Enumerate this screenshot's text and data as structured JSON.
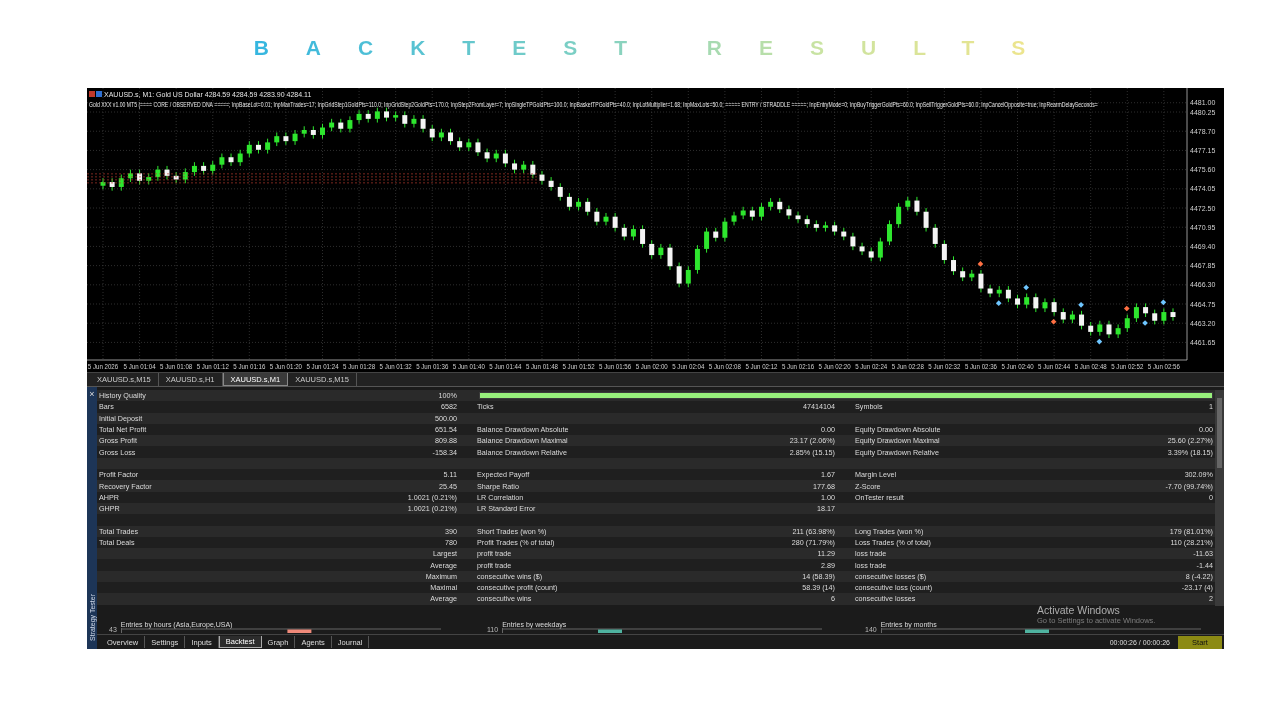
{
  "title": "BACKTEST RESULTS",
  "chart": {
    "symbol_line": "XAUUSD.s, M1:  Gold US Dollar  4284.59 4284.59 4283.90 4284.11",
    "parameters_line": "Gold XXX v1.00 MT5 (==== CORE / OBSERVED DNA =====; InpBaseLot=0.01; InpMaxTrades=17; InpGridStep1GoldPts=110.0; InpGridStep2GoldPts=170.0; InpStep2FromLayer=7; InpSingleTPGoldPts=100.0; InpBasketTPGoldPts=40.0; InpLotMultiplier=1.68; InpMaxLots=50.0; ===== ENTRY / STRADDLE =====; InpEntryMode=0; InpBuyTriggerGoldPts=60.0; InpSellTriggerGoldPts=60.0; InpCancelOpposite=true; InpRearmDelaySeconds=",
    "chart_data": {
      "type": "candlestick",
      "categories": [
        "5 Jun 2026",
        null,
        null,
        null,
        "5 Jun 01:04",
        null,
        null,
        null,
        "5 Jun 01:08",
        null,
        null,
        null,
        "5 Jun 01:12",
        null,
        null,
        null,
        "5 Jun 01:16",
        null,
        null,
        null,
        "5 Jun 01:20",
        null,
        null,
        null,
        "5 Jun 01:24",
        null,
        null,
        null,
        "5 Jun 01:28",
        null,
        null,
        null,
        "5 Jun 01:32",
        null,
        null,
        null,
        "5 Jun 01:36",
        null,
        null,
        null,
        "5 Jun 01:40",
        null,
        null,
        null,
        "5 Jun 01:44",
        null,
        null,
        null,
        "5 Jun 01:48",
        null,
        null,
        null,
        "5 Jun 01:52",
        null,
        null,
        null,
        "5 Jun 01:56",
        null,
        null,
        null,
        "5 Jun 02:00",
        null,
        null,
        null,
        "5 Jun 02:04",
        null,
        null,
        null,
        "5 Jun 02:08",
        null,
        null,
        null,
        "5 Jun 02:12",
        null,
        null,
        null,
        "5 Jun 02:16",
        null,
        null,
        null,
        "5 Jun 02:20",
        null,
        null,
        null,
        "5 Jun 02:24",
        null,
        null,
        null,
        "5 Jun 02:28",
        null,
        null,
        null,
        "5 Jun 02:32",
        null,
        null,
        null,
        "5 Jun 02:36",
        null,
        null,
        null,
        "5 Jun 02:40",
        null,
        null,
        null,
        "5 Jun 02:44",
        null,
        null,
        null,
        "5 Jun 02:48",
        null,
        null,
        null,
        "5 Jun 02:52",
        null,
        null,
        null,
        "5 Jun 02:56",
        null
      ],
      "ylim": [
        4460.23,
        4482.19
      ],
      "grid": true,
      "ohlc": [
        [
          4474.3,
          4474.9,
          4474.0,
          4474.6
        ],
        [
          4474.6,
          4474.9,
          4473.9,
          4474.2
        ],
        [
          4474.2,
          4475.2,
          4473.9,
          4474.9
        ],
        [
          4474.9,
          4475.6,
          4474.6,
          4475.3
        ],
        [
          4475.3,
          4475.6,
          4474.4,
          4474.7
        ],
        [
          4474.7,
          4475.3,
          4474.4,
          4475.0
        ],
        [
          4475.0,
          4475.9,
          4474.7,
          4475.6
        ],
        [
          4475.6,
          4475.9,
          4474.8,
          4475.1
        ],
        [
          4475.1,
          4475.4,
          4474.5,
          4474.8
        ],
        [
          4474.8,
          4475.7,
          4474.5,
          4475.4
        ],
        [
          4475.4,
          4476.2,
          4475.1,
          4475.9
        ],
        [
          4475.9,
          4476.2,
          4475.2,
          4475.5
        ],
        [
          4475.5,
          4476.3,
          4475.2,
          4476.0
        ],
        [
          4476.0,
          4476.9,
          4475.7,
          4476.6
        ],
        [
          4476.6,
          4476.9,
          4475.9,
          4476.2
        ],
        [
          4476.2,
          4477.2,
          4475.9,
          4476.9
        ],
        [
          4476.9,
          4477.9,
          4476.6,
          4477.6
        ],
        [
          4477.6,
          4477.9,
          4476.9,
          4477.2
        ],
        [
          4477.2,
          4478.1,
          4476.9,
          4477.8
        ],
        [
          4477.8,
          4478.6,
          4477.5,
          4478.3
        ],
        [
          4478.3,
          4478.6,
          4477.6,
          4477.9
        ],
        [
          4477.9,
          4478.8,
          4477.6,
          4478.5
        ],
        [
          4478.5,
          4479.1,
          4478.2,
          4478.8
        ],
        [
          4478.8,
          4479.1,
          4478.1,
          4478.4
        ],
        [
          4478.4,
          4479.3,
          4478.1,
          4479.0
        ],
        [
          4479.0,
          4479.7,
          4478.7,
          4479.4
        ],
        [
          4479.4,
          4479.7,
          4478.6,
          4478.9
        ],
        [
          4478.9,
          4479.9,
          4478.6,
          4479.6
        ],
        [
          4479.6,
          4480.4,
          4479.3,
          4480.1
        ],
        [
          4480.1,
          4480.4,
          4479.4,
          4479.7
        ],
        [
          4479.7,
          4480.6,
          4479.4,
          4480.3
        ],
        [
          4480.3,
          4480.6,
          4479.5,
          4479.8
        ],
        [
          4479.8,
          4480.3,
          4479.5,
          4480.0
        ],
        [
          4480.0,
          4480.3,
          4479.0,
          4479.3
        ],
        [
          4479.3,
          4480.0,
          4479.0,
          4479.7
        ],
        [
          4479.7,
          4480.0,
          4478.6,
          4478.9
        ],
        [
          4478.9,
          4479.2,
          4477.9,
          4478.2
        ],
        [
          4478.2,
          4478.9,
          4477.9,
          4478.6
        ],
        [
          4478.6,
          4478.9,
          4477.6,
          4477.9
        ],
        [
          4477.9,
          4478.2,
          4477.1,
          4477.4
        ],
        [
          4477.4,
          4478.1,
          4477.1,
          4477.8
        ],
        [
          4477.8,
          4478.1,
          4476.7,
          4477.0
        ],
        [
          4477.0,
          4477.3,
          4476.2,
          4476.5
        ],
        [
          4476.5,
          4477.2,
          4476.2,
          4476.9
        ],
        [
          4476.9,
          4477.2,
          4475.8,
          4476.1
        ],
        [
          4476.1,
          4476.4,
          4475.3,
          4475.6
        ],
        [
          4475.6,
          4476.3,
          4475.3,
          4476.0
        ],
        [
          4476.0,
          4476.3,
          4474.9,
          4475.2
        ],
        [
          4475.2,
          4475.5,
          4474.4,
          4474.7
        ],
        [
          4474.7,
          4475.0,
          4473.9,
          4474.2
        ],
        [
          4474.2,
          4474.5,
          4473.1,
          4473.4
        ],
        [
          4473.4,
          4473.7,
          4472.3,
          4472.6
        ],
        [
          4472.6,
          4473.3,
          4472.3,
          4473.0
        ],
        [
          4473.0,
          4473.3,
          4471.9,
          4472.2
        ],
        [
          4472.2,
          4472.5,
          4471.1,
          4471.4
        ],
        [
          4471.4,
          4472.1,
          4471.1,
          4471.8
        ],
        [
          4471.8,
          4472.1,
          4470.6,
          4470.9
        ],
        [
          4470.9,
          4471.2,
          4469.9,
          4470.2
        ],
        [
          4470.2,
          4471.1,
          4469.9,
          4470.8
        ],
        [
          4470.8,
          4471.1,
          4469.3,
          4469.6
        ],
        [
          4469.6,
          4469.9,
          4468.4,
          4468.7
        ],
        [
          4468.7,
          4469.6,
          4468.4,
          4469.3
        ],
        [
          4469.3,
          4469.6,
          4467.5,
          4467.8
        ],
        [
          4467.8,
          4468.1,
          4466.1,
          4466.4
        ],
        [
          4466.4,
          4467.8,
          4466.1,
          4467.5
        ],
        [
          4467.5,
          4469.5,
          4467.2,
          4469.2
        ],
        [
          4469.2,
          4470.9,
          4468.9,
          4470.6
        ],
        [
          4470.6,
          4470.9,
          4469.8,
          4470.1
        ],
        [
          4470.1,
          4471.7,
          4469.8,
          4471.4
        ],
        [
          4471.4,
          4472.2,
          4471.1,
          4471.9
        ],
        [
          4471.9,
          4472.6,
          4471.6,
          4472.3
        ],
        [
          4472.3,
          4472.6,
          4471.5,
          4471.8
        ],
        [
          4471.8,
          4472.9,
          4471.5,
          4472.6
        ],
        [
          4472.6,
          4473.3,
          4472.3,
          4473.0
        ],
        [
          4473.0,
          4473.3,
          4472.1,
          4472.4
        ],
        [
          4472.4,
          4472.7,
          4471.6,
          4471.9
        ],
        [
          4471.9,
          4472.2,
          4471.3,
          4471.6
        ],
        [
          4471.6,
          4471.9,
          4470.9,
          4471.2
        ],
        [
          4471.2,
          4471.5,
          4470.6,
          4470.9
        ],
        [
          4470.9,
          4471.4,
          4470.6,
          4471.1
        ],
        [
          4471.1,
          4471.4,
          4470.3,
          4470.6
        ],
        [
          4470.6,
          4470.9,
          4469.9,
          4470.2
        ],
        [
          4470.2,
          4470.5,
          4469.1,
          4469.4
        ],
        [
          4469.4,
          4469.7,
          4468.7,
          4469.0
        ],
        [
          4469.0,
          4469.3,
          4468.2,
          4468.5
        ],
        [
          4468.5,
          4470.1,
          4468.2,
          4469.8
        ],
        [
          4469.8,
          4471.5,
          4469.5,
          4471.2
        ],
        [
          4471.2,
          4472.9,
          4470.9,
          4472.6
        ],
        [
          4472.6,
          4473.4,
          4472.3,
          4473.1
        ],
        [
          4473.1,
          4473.4,
          4471.9,
          4472.2
        ],
        [
          4472.2,
          4472.5,
          4470.6,
          4470.9
        ],
        [
          4470.9,
          4471.2,
          4469.3,
          4469.6
        ],
        [
          4469.6,
          4469.9,
          4468.0,
          4468.3
        ],
        [
          4468.3,
          4468.6,
          4467.1,
          4467.4
        ],
        [
          4467.4,
          4467.7,
          4466.6,
          4466.9
        ],
        [
          4466.9,
          4467.5,
          4466.6,
          4467.2
        ],
        [
          4467.2,
          4467.5,
          4465.7,
          4466.0
        ],
        [
          4466.0,
          4466.3,
          4465.3,
          4465.6
        ],
        [
          4465.6,
          4466.2,
          4465.3,
          4465.9
        ],
        [
          4465.9,
          4466.2,
          4464.9,
          4465.2
        ],
        [
          4465.2,
          4465.5,
          4464.4,
          4464.7
        ],
        [
          4464.7,
          4465.6,
          4464.4,
          4465.3
        ],
        [
          4465.3,
          4465.6,
          4464.1,
          4464.4
        ],
        [
          4464.4,
          4465.2,
          4464.1,
          4464.9
        ],
        [
          4464.9,
          4465.2,
          4463.8,
          4464.1
        ],
        [
          4464.1,
          4464.4,
          4463.2,
          4463.5
        ],
        [
          4463.5,
          4464.2,
          4463.2,
          4463.9
        ],
        [
          4463.9,
          4464.2,
          4462.7,
          4463.0
        ],
        [
          4463.0,
          4463.3,
          4462.2,
          4462.5
        ],
        [
          4462.5,
          4463.4,
          4462.2,
          4463.1
        ],
        [
          4463.1,
          4463.4,
          4462.0,
          4462.3
        ],
        [
          4462.3,
          4463.1,
          4462.0,
          4462.8
        ],
        [
          4462.8,
          4463.9,
          4462.5,
          4463.6
        ],
        [
          4463.6,
          4464.8,
          4463.3,
          4464.5
        ],
        [
          4464.5,
          4464.8,
          4463.7,
          4464.0
        ],
        [
          4464.0,
          4464.3,
          4463.1,
          4463.4
        ],
        [
          4463.4,
          4464.4,
          4463.1,
          4464.1
        ],
        [
          4464.1,
          4464.4,
          4463.4,
          4463.7
        ]
      ],
      "yticks": [
        {
          "value": 4481.0,
          "label": "4481.00"
        },
        {
          "value": 4480.25,
          "label": "4480.25"
        },
        {
          "value": 4478.7,
          "label": "4478.70"
        },
        {
          "value": 4477.15,
          "label": "4477.15"
        },
        {
          "value": 4475.6,
          "label": "4475.60"
        },
        {
          "value": 4474.05,
          "label": "4474.05"
        },
        {
          "value": 4472.5,
          "label": "4472.50"
        },
        {
          "value": 4470.95,
          "label": "4470.95"
        },
        {
          "value": 4469.4,
          "label": "4469.40"
        },
        {
          "value": 4467.85,
          "label": "4467.85"
        },
        {
          "value": 4466.3,
          "label": "4466.30"
        },
        {
          "value": 4464.75,
          "label": "4464.75"
        },
        {
          "value": 4463.2,
          "label": "4463.20"
        },
        {
          "value": 4461.65,
          "label": "4461.65"
        }
      ]
    }
  },
  "chart_tabs": [
    {
      "label": "XAUUSD.s,M15",
      "selected": false
    },
    {
      "label": "XAUUSD.s,H1",
      "selected": false
    },
    {
      "label": "XAUUSD.s,M1",
      "selected": true
    },
    {
      "label": "XAUUSD.s,M15",
      "selected": false
    }
  ],
  "tester": {
    "close": "×",
    "side_label": "Strategy Tester",
    "report": {
      "rows": [
        {
          "kind": "quality",
          "cells": [
            {
              "label": "History Quality",
              "value": "100%"
            }
          ],
          "level": 1
        },
        {
          "kind": "stat",
          "cells": [
            {
              "label": "Bars",
              "value": "6582"
            },
            {
              "label": "Ticks",
              "value": "47414104"
            },
            {
              "label": "Symbols",
              "value": "1"
            }
          ]
        },
        {
          "kind": "stat",
          "cells": [
            {
              "label": "Initial Deposit",
              "value": "500.00"
            }
          ]
        },
        {
          "kind": "stat",
          "cells": [
            {
              "label": "Total Net Profit",
              "value": "651.54"
            },
            {
              "label": "Balance Drawdown Absolute",
              "value": "0.00"
            },
            {
              "label": "Equity Drawdown Absolute",
              "value": "0.00"
            }
          ]
        },
        {
          "kind": "stat",
          "cells": [
            {
              "label": "Gross Profit",
              "value": "809.88"
            },
            {
              "label": "Balance Drawdown Maximal",
              "value": "23.17 (2.06%)"
            },
            {
              "label": "Equity Drawdown Maximal",
              "value": "25.60 (2.27%)"
            }
          ]
        },
        {
          "kind": "stat",
          "cells": [
            {
              "label": "Gross Loss",
              "value": "-158.34"
            },
            {
              "label": "Balance Drawdown Relative",
              "value": "2.85% (15.15)"
            },
            {
              "label": "Equity Drawdown Relative",
              "value": "3.39% (18.15)"
            }
          ]
        },
        {
          "kind": "blank"
        },
        {
          "kind": "stat",
          "cells": [
            {
              "label": "Profit Factor",
              "value": "5.11"
            },
            {
              "label": "Expected Payoff",
              "value": "1.67"
            },
            {
              "label": "Margin Level",
              "value": "302.09%"
            }
          ]
        },
        {
          "kind": "stat",
          "cells": [
            {
              "label": "Recovery Factor",
              "value": "25.45"
            },
            {
              "label": "Sharpe Ratio",
              "value": "177.68"
            },
            {
              "label": "Z-Score",
              "value": "-7.70 (99.74%)"
            }
          ]
        },
        {
          "kind": "stat",
          "cells": [
            {
              "label": "AHPR",
              "value": "1.0021 (0.21%)"
            },
            {
              "label": "LR Correlation",
              "value": "1.00"
            },
            {
              "label": "OnTester result",
              "value": "0"
            }
          ]
        },
        {
          "kind": "stat",
          "cells": [
            {
              "label": "GHPR",
              "value": "1.0021 (0.21%)"
            },
            {
              "label": "LR Standard Error",
              "value": "18.17"
            }
          ]
        },
        {
          "kind": "blank"
        },
        {
          "kind": "stat",
          "cells": [
            {
              "label": "Total Trades",
              "value": "390"
            },
            {
              "label": "Short Trades (won %)",
              "value": "211 (63.98%)"
            },
            {
              "label": "Long Trades (won %)",
              "value": "179 (81.01%)"
            }
          ]
        },
        {
          "kind": "stat",
          "cells": [
            {
              "label": "Total Deals",
              "value": "780"
            },
            {
              "label": "Profit Trades (% of total)",
              "value": "280 (71.79%)"
            },
            {
              "label": "Loss Trades (% of total)",
              "value": "110 (28.21%)"
            }
          ]
        },
        {
          "kind": "sub",
          "cells": [
            {
              "label": "Largest"
            },
            {
              "label": "profit trade",
              "value": "11.29"
            },
            {
              "label": "loss trade",
              "value": "-11.63"
            }
          ]
        },
        {
          "kind": "sub",
          "cells": [
            {
              "label": "Average"
            },
            {
              "label": "profit trade",
              "value": "2.89"
            },
            {
              "label": "loss trade",
              "value": "-1.44"
            }
          ]
        },
        {
          "kind": "sub",
          "cells": [
            {
              "label": "Maximum"
            },
            {
              "label": "consecutive wins ($)",
              "value": "14 (58.39)"
            },
            {
              "label": "consecutive losses ($)",
              "value": "8 (-4.22)"
            }
          ]
        },
        {
          "kind": "sub",
          "cells": [
            {
              "label": "Maximal"
            },
            {
              "label": "consecutive profit (count)",
              "value": "58.39 (14)"
            },
            {
              "label": "consecutive loss (count)",
              "value": "-23.17 (4)"
            }
          ]
        },
        {
          "kind": "sub",
          "cells": [
            {
              "label": "Average"
            },
            {
              "label": "consecutive wins",
              "value": "6"
            },
            {
              "label": "consecutive losses",
              "value": "2"
            }
          ]
        }
      ]
    },
    "histograms": [
      {
        "title": "Entries by hours (Asia,Europe,USA)",
        "axis_label": "43"
      },
      {
        "title": "Entries by weekdays",
        "axis_label": "110"
      },
      {
        "title": "Entries by months",
        "axis_label": "140"
      }
    ],
    "tabs": [
      {
        "label": "Overview",
        "selected": false
      },
      {
        "label": "Settings",
        "selected": false
      },
      {
        "label": "Inputs",
        "selected": false
      },
      {
        "label": "Backtest",
        "selected": true
      },
      {
        "label": "Graph",
        "selected": false
      },
      {
        "label": "Agents",
        "selected": false
      },
      {
        "label": "Journal",
        "selected": false
      }
    ],
    "elapsed": "00:00:26 / 00:00:26",
    "start_button": "Start"
  },
  "os_notice": {
    "title": "Activate Windows",
    "subtitle": "Go to Settings to activate Windows."
  }
}
